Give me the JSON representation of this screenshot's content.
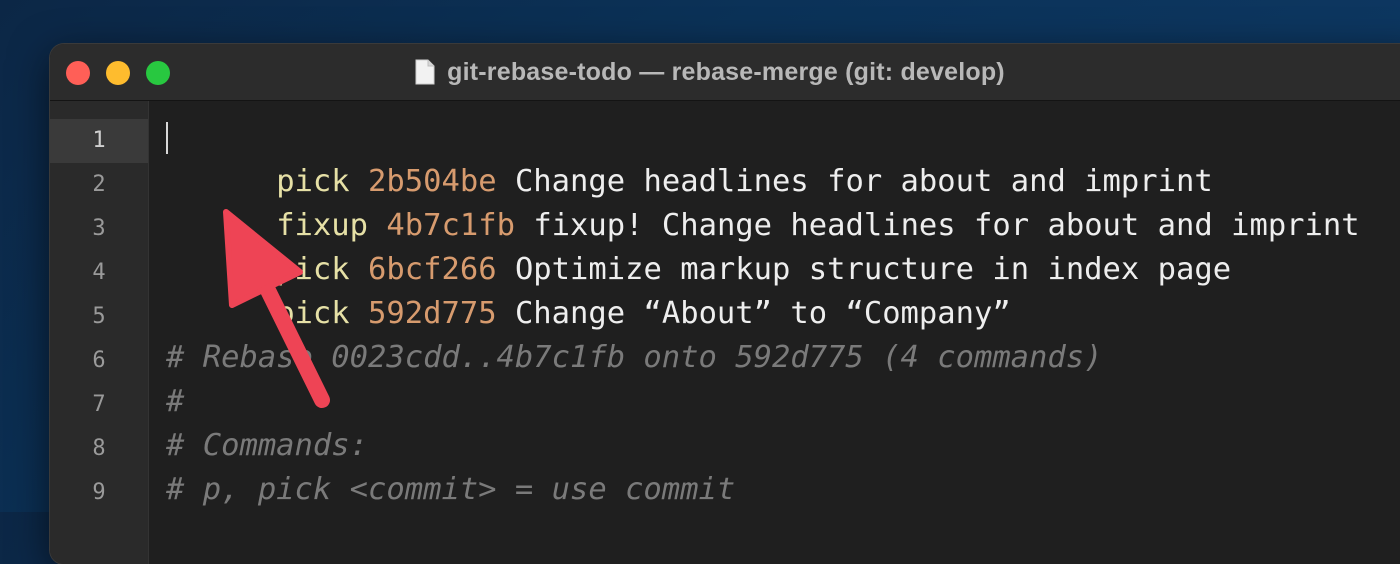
{
  "window": {
    "title": "git-rebase-todo — rebase-merge (git: develop)",
    "title_icon": "document-icon"
  },
  "gutter": {
    "line_numbers": [
      "1",
      "2",
      "3",
      "4",
      "5",
      "6",
      "7",
      "8",
      "9"
    ],
    "active_line": 1
  },
  "lines": [
    {
      "command": "pick",
      "hash": "2b504be",
      "message": "Change headlines for about and imprint"
    },
    {
      "command": "fixup",
      "hash": "4b7c1fb",
      "message": "fixup! Change headlines for about and imprint"
    },
    {
      "command": "pick",
      "hash": "6bcf266",
      "message": "Optimize markup structure in index page"
    },
    {
      "command": "pick",
      "hash": "592d775",
      "message": "Change “About” to “Company”"
    }
  ],
  "comments": [
    "# Rebase 0023cdd..4b7c1fb onto 592d775 (4 commands)",
    "#",
    "# Commands:",
    "# p, pick <commit> = use commit"
  ],
  "annotation": {
    "type": "arrow",
    "color": "#ee4455",
    "points_to": "fixup"
  },
  "colors": {
    "background": "#0b3258",
    "editor_bg": "#1f1f1f",
    "command": "#e6e0a6",
    "hash": "#d79b6e",
    "comment": "#7a7a7a"
  }
}
